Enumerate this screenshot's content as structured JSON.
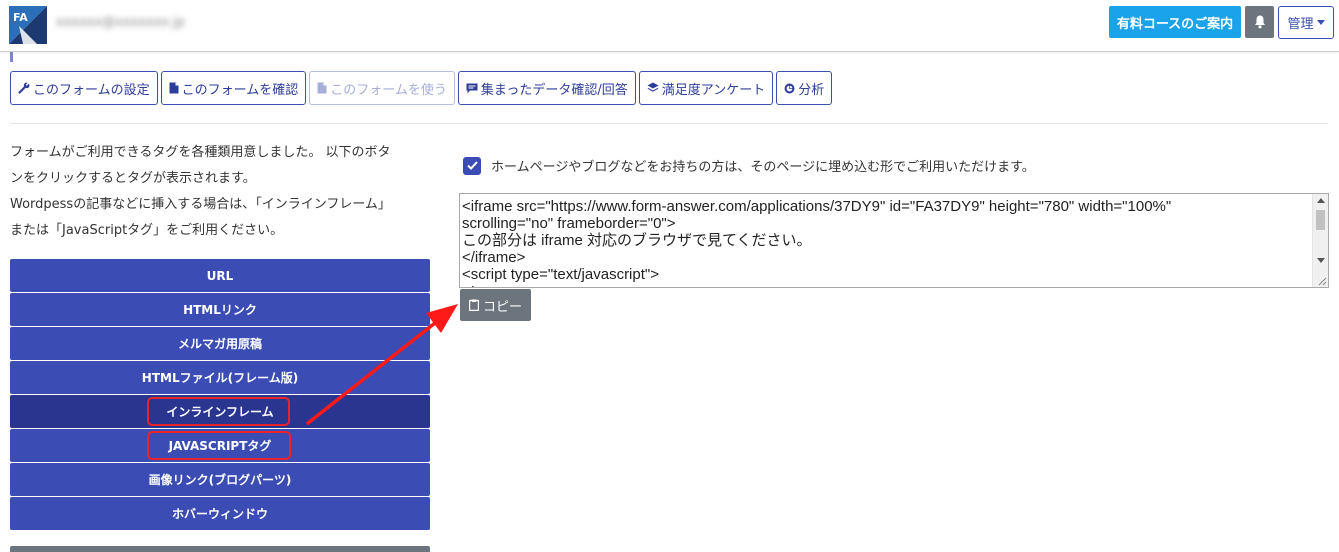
{
  "header": {
    "user_email": "xxxxxx@xxxxxxx.jp",
    "paid_course_label": "有料コースのご案内",
    "admin_label": "管理"
  },
  "icons": {
    "logo": "logo-icon",
    "bell": "bell-icon",
    "wrench": "wrench-icon",
    "file": "file-icon",
    "chat": "chat-icon",
    "layers": "layers-icon",
    "chart": "chart-icon",
    "clipboard": "clipboard-icon",
    "check": "check-icon"
  },
  "toolbar": {
    "settings_label": "このフォームの設定",
    "confirm_label": "このフォームを確認",
    "use_label": "このフォームを使う",
    "data_label": "集まったデータ確認/回答",
    "survey_label": "満足度アンケート",
    "analysis_label": "分析"
  },
  "description": {
    "line1": "フォームがご利用できるタグを各種類用意しました。 以下のボタ",
    "line2": "ンをクリックするとタグが表示されます。",
    "line3": "Wordpessの記事などに挿入する場合は、「インラインフレーム」",
    "line4": "または「JavaScriptタグ」をご利用ください。"
  },
  "tags": {
    "url": "URL",
    "html_link": "HTMLリンク",
    "mailmag": "メルマガ用原稿",
    "html_file": "HTMLファイル(フレーム版)",
    "inline_frame": "インラインフレーム",
    "javascript": "JAVASCRIPTタグ",
    "image_link": "画像リンク(ブログパーツ)",
    "hover_window": "ホバーウィンドウ"
  },
  "embed": {
    "checkbox_label": "ホームページやブログなどをお持ちの方は、そのページに埋め込む形でご利用いただけます。",
    "code": "<iframe src=\"https://www.form-answer.com/applications/37DY9\" id=\"FA37DY9\" height=\"780\" width=\"100%\"\nscrolling=\"no\" frameborder=\"0\">\nこの部分は iframe 対応のブラウザで見てください。\n</iframe>\n<script type=\"text/javascript\">\n<!--",
    "copy_label": "コピー"
  },
  "colors": {
    "primary": "#3b4db4",
    "primary_active": "#2a3590",
    "info": "#1aa3e8",
    "secondary": "#6c757d",
    "highlight": "#e8232a"
  }
}
